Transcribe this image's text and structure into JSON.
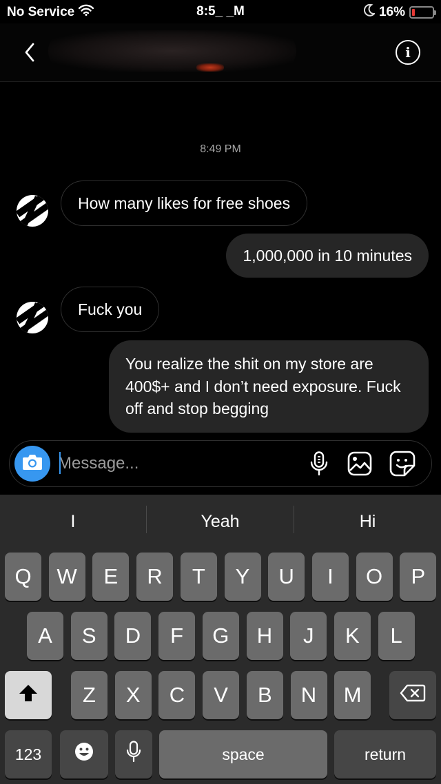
{
  "status_bar": {
    "carrier": "No Service",
    "time": "8:5_ _M",
    "battery": "16%",
    "battery_level": 0.16,
    "battery_color": "#e53935"
  },
  "header": {
    "back_icon": "chevron-left-icon",
    "info_icon": "info-icon",
    "info_glyph": "i"
  },
  "chat": {
    "timestamp": "8:49 PM",
    "messages": [
      {
        "from": "them",
        "text": "How many likes for free shoes"
      },
      {
        "from": "me",
        "text": "1,000,000 in 10 minutes"
      },
      {
        "from": "them",
        "text": "Fuck you"
      },
      {
        "from": "me",
        "text": "You realize the shit on my store are 400$+ and I don’t need exposure. Fuck off and stop begging"
      }
    ]
  },
  "composer": {
    "placeholder": "Message...",
    "value": "",
    "accent": "#3797f0",
    "icons": [
      "camera-icon",
      "microphone-icon",
      "gallery-icon",
      "sticker-icon"
    ]
  },
  "keyboard": {
    "suggestions": [
      "I",
      "Yeah",
      "Hi"
    ],
    "row1": [
      "Q",
      "W",
      "E",
      "R",
      "T",
      "Y",
      "U",
      "I",
      "O",
      "P"
    ],
    "row2": [
      "A",
      "S",
      "D",
      "F",
      "G",
      "H",
      "J",
      "K",
      "L"
    ],
    "row3": [
      "Z",
      "X",
      "C",
      "V",
      "B",
      "N",
      "M"
    ],
    "numbers_label": "123",
    "space_label": "space",
    "return_label": "return",
    "icons": [
      "shift-icon",
      "backspace-icon",
      "emoji-icon",
      "dictation-icon"
    ]
  }
}
